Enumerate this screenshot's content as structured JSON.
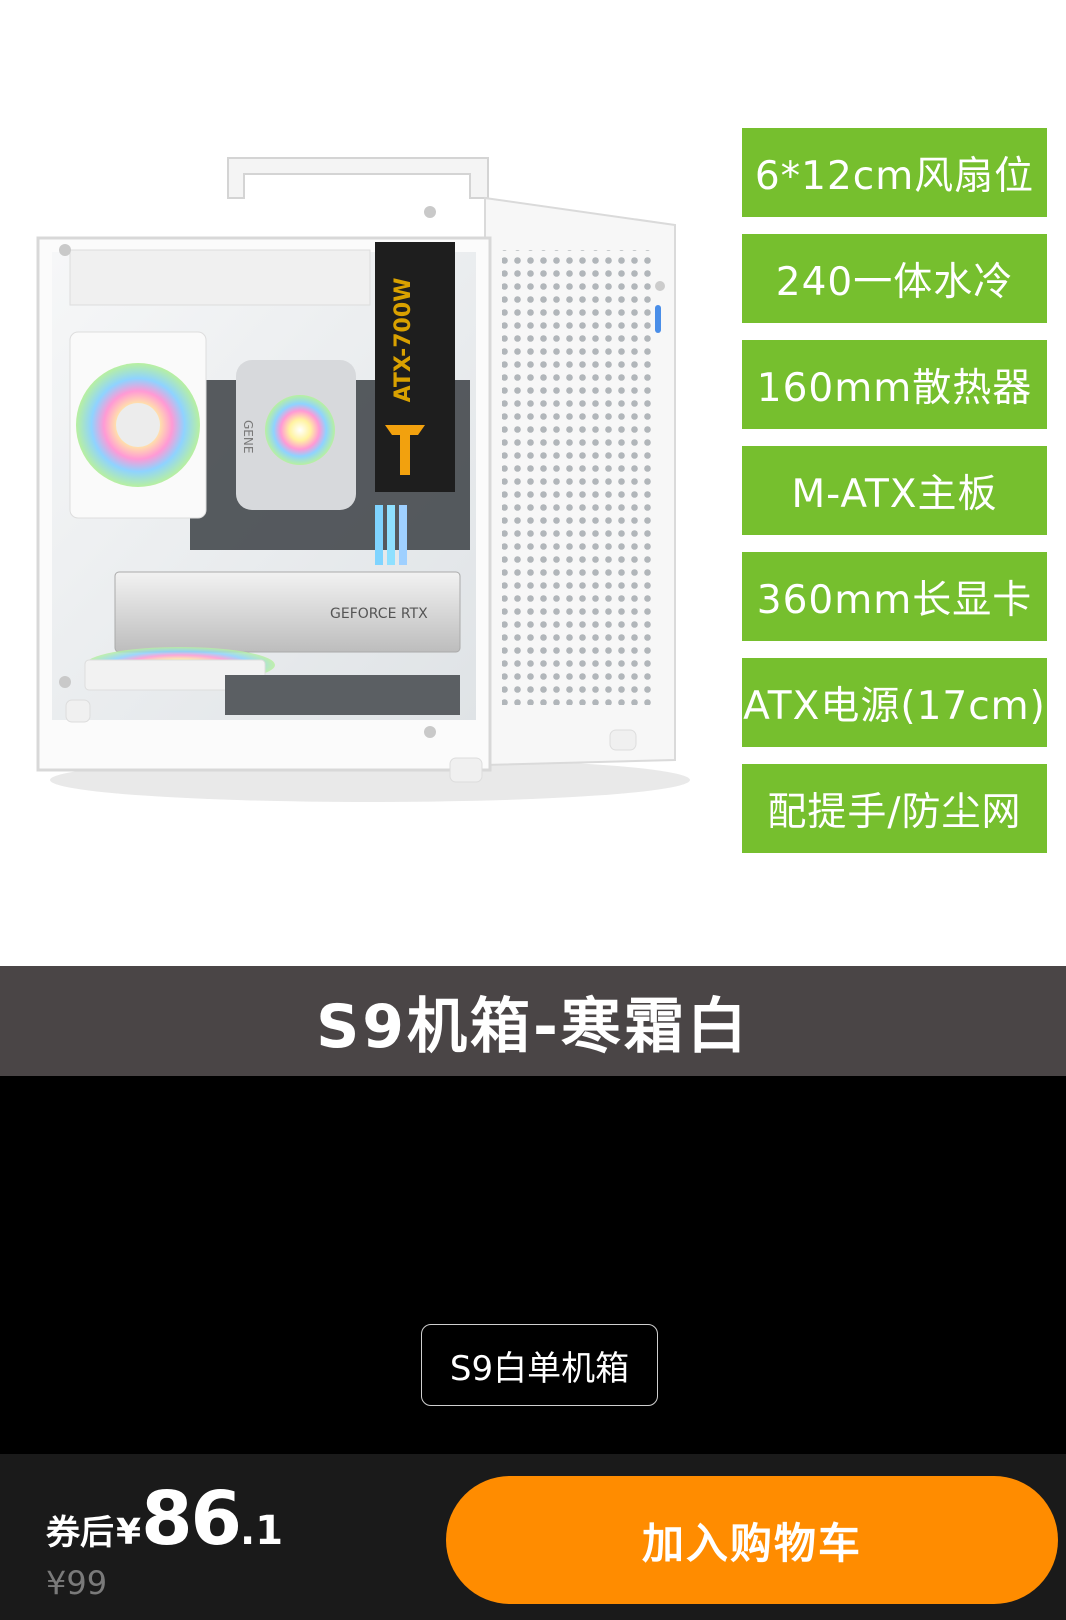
{
  "product_image": {
    "psu_label": "ATX-700W",
    "gpu_label": "GEFORCE RTX",
    "board_label": "GENE",
    "features": [
      "6*12cm风扇位",
      "240一体水冷",
      "160mm散热器",
      "M-ATX主板",
      "360mm长显卡",
      "ATX电源(17cm)",
      "配提手/防尘网"
    ]
  },
  "banner": {
    "title": "S9机箱-寒霜白"
  },
  "variants": {
    "selected_label": "S9白单机箱"
  },
  "bottom_bar": {
    "price_prefix": "券后",
    "currency": "¥",
    "price_integer": "86",
    "price_decimal": ".1",
    "original_price": "¥99",
    "add_to_cart_label": "加入购物车"
  },
  "colors": {
    "accent": "#ff8c00",
    "feature_green": "#76bf2e",
    "banner_bg": "#4a4546"
  }
}
